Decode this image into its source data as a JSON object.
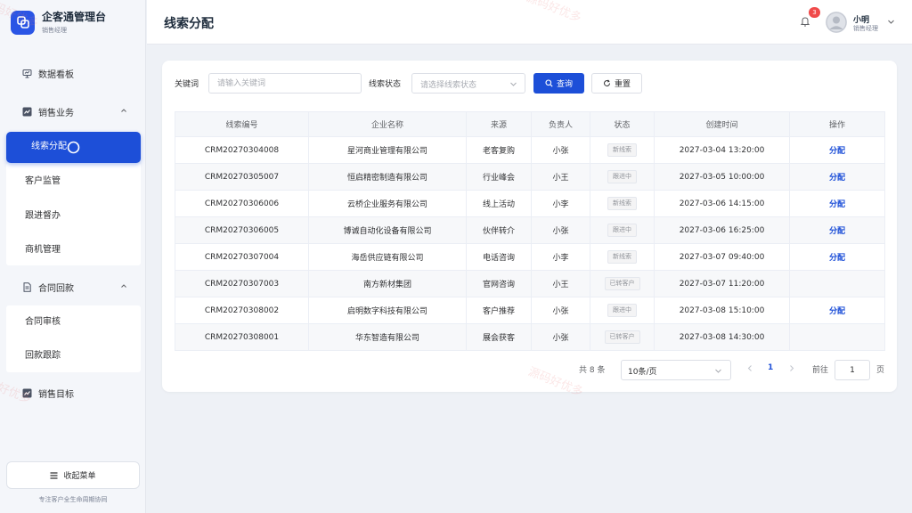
{
  "brand": {
    "title": "企客通管理台",
    "subtitle": "销售经理"
  },
  "sidebar": {
    "dashboard": "数据看板",
    "groups": [
      {
        "label": "销售业务",
        "items": [
          "线索分配",
          "客户监管",
          "跟进督办",
          "商机管理"
        ]
      },
      {
        "label": "合同回款",
        "items": [
          "合同审核",
          "回款跟踪"
        ]
      },
      {
        "label": "销售目标",
        "items": []
      }
    ],
    "active_item": "线索分配",
    "collapse_label": "收起菜单",
    "footer": "专注客户全生命周期协同"
  },
  "header": {
    "title": "线索分配",
    "notification_count": "3",
    "user_name": "小明",
    "user_role": "销售经理"
  },
  "filter": {
    "keyword_label": "关键词",
    "keyword_placeholder": "请输入关键词",
    "status_label": "线索状态",
    "status_placeholder": "请选择线索状态",
    "query_label": "查询",
    "reset_label": "重置"
  },
  "table": {
    "columns": [
      "线索编号",
      "企业名称",
      "来源",
      "负责人",
      "状态",
      "创建时间",
      "操作"
    ],
    "rows": [
      {
        "id": "CRM20270304008",
        "company": "星河商业管理有限公司",
        "source": "老客复购",
        "owner": "小张",
        "status": "新线索",
        "created": "2027-03-04 13:20:00",
        "action": "分配"
      },
      {
        "id": "CRM20270305007",
        "company": "恒启精密制造有限公司",
        "source": "行业峰会",
        "owner": "小王",
        "status": "跟进中",
        "created": "2027-03-05 10:00:00",
        "action": "分配"
      },
      {
        "id": "CRM20270306006",
        "company": "云桥企业服务有限公司",
        "source": "线上活动",
        "owner": "小李",
        "status": "新线索",
        "created": "2027-03-06 14:15:00",
        "action": "分配"
      },
      {
        "id": "CRM20270306005",
        "company": "博诚自动化设备有限公司",
        "source": "伙伴转介",
        "owner": "小张",
        "status": "跟进中",
        "created": "2027-03-06 16:25:00",
        "action": "分配"
      },
      {
        "id": "CRM20270307004",
        "company": "海岳供应链有限公司",
        "source": "电话咨询",
        "owner": "小李",
        "status": "新线索",
        "created": "2027-03-07 09:40:00",
        "action": "分配"
      },
      {
        "id": "CRM20270307003",
        "company": "南方新材集团",
        "source": "官网咨询",
        "owner": "小王",
        "status": "已转客户",
        "created": "2027-03-07 11:20:00",
        "action": ""
      },
      {
        "id": "CRM20270308002",
        "company": "启明数字科技有限公司",
        "source": "客户推荐",
        "owner": "小张",
        "status": "跟进中",
        "created": "2027-03-08 15:10:00",
        "action": "分配"
      },
      {
        "id": "CRM20270308001",
        "company": "华东智造有限公司",
        "source": "展会获客",
        "owner": "小张",
        "status": "已转客户",
        "created": "2027-03-08 14:30:00",
        "action": ""
      }
    ]
  },
  "pagination": {
    "total_text": "共 8 条",
    "page_size": "10条/页",
    "current_page": "1",
    "goto_label": "前往",
    "goto_value": "1",
    "page_suffix": "页"
  },
  "watermark": "源码好优多",
  "colors": {
    "primary": "#1d4fd8",
    "badge": "#f04a4a"
  }
}
